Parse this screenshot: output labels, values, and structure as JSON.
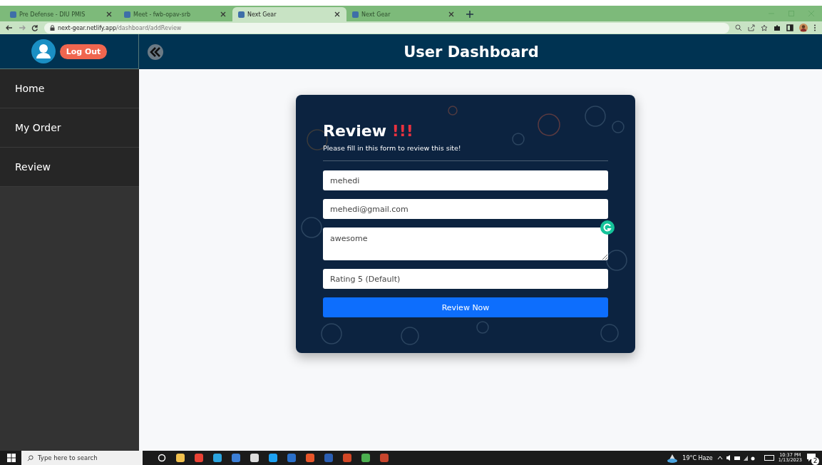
{
  "browser": {
    "tabs": [
      {
        "title": "Pre Defense - DIU PMIS",
        "selected": false
      },
      {
        "title": "Meet - fwb-opav-srb",
        "selected": false
      },
      {
        "title": "Next Gear",
        "selected": true
      },
      {
        "title": "Next Gear",
        "selected": false
      }
    ],
    "url_host": "next-gear.netlify.app",
    "url_path": "/dashboard/addReview"
  },
  "header": {
    "logout": "Log Out",
    "title": "User Dashboard"
  },
  "sidebar": {
    "items": [
      {
        "label": "Home"
      },
      {
        "label": "My Order"
      },
      {
        "label": "Review"
      }
    ]
  },
  "form": {
    "title": "Review",
    "title_mark": "!!!",
    "subtitle": "Please fill in this form to review this site!",
    "fields": [
      {
        "kind": "input",
        "value": "mehedi"
      },
      {
        "kind": "input",
        "value": "mehedi@gmail.com"
      },
      {
        "kind": "textarea",
        "value": "awesome"
      },
      {
        "kind": "input",
        "value": "Rating 5 (Default)"
      }
    ],
    "submit": "Review Now"
  },
  "taskbar": {
    "search_placeholder": "Type here to search",
    "weather": "19°C  Haze",
    "time": "10:37 PM",
    "date": "1/13/2023",
    "notifications": "2"
  }
}
